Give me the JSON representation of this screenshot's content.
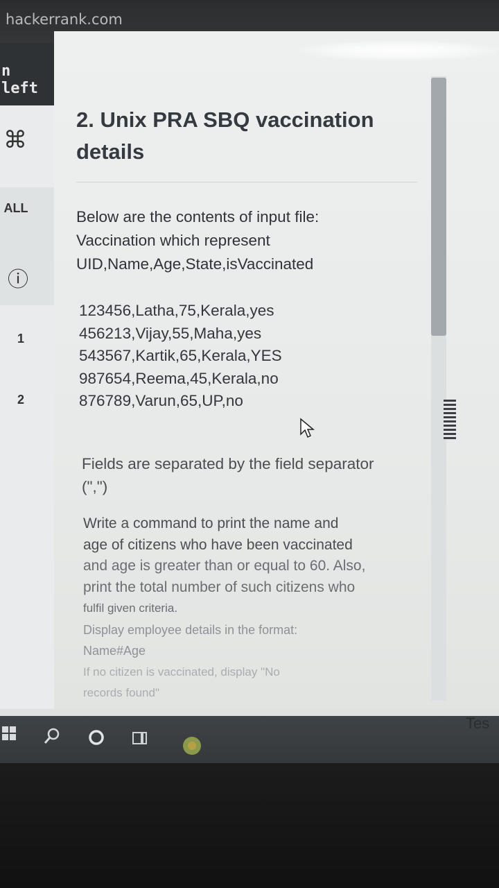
{
  "browser": {
    "url": "hackerrank.com"
  },
  "sidebar": {
    "timer_label": "n left",
    "items": [
      {
        "label": "⌘"
      },
      {
        "label": "ALL"
      },
      {
        "label": "ⓘ"
      },
      {
        "label": "1"
      },
      {
        "label": "2"
      }
    ]
  },
  "question": {
    "title": "2. Unix PRA SBQ vaccination details",
    "intro_lines": [
      "Below are the contents of input file:",
      "Vaccination which represent",
      "UID,Name,Age,State,isVaccinated"
    ],
    "records": [
      "123456,Latha,75,Kerala,yes",
      "456213,Vijay,55,Maha,yes",
      "543567,Kartik,65,Kerala,YES",
      "987654,Reema,45,Kerala,no",
      "876789,Varun,65,UP,no"
    ],
    "separator_lines": [
      "Fields are separated by the field separator",
      "(\",\")"
    ],
    "task_lines": [
      "Write a command to print the name and",
      "age of citizens who have been vaccinated",
      "and age is greater than or equal to 60. Also,",
      "print the total number of such citizens who",
      "fulfil given criteria.",
      "Display employee details in the format:",
      "Name#Age",
      "If no citizen is vaccinated, display \"No",
      "records found\""
    ]
  },
  "right_tab": {
    "label": "Tes"
  },
  "taskbar": {
    "icons": [
      "windows-start",
      "search",
      "cortana",
      "task-view",
      "chrome"
    ]
  }
}
